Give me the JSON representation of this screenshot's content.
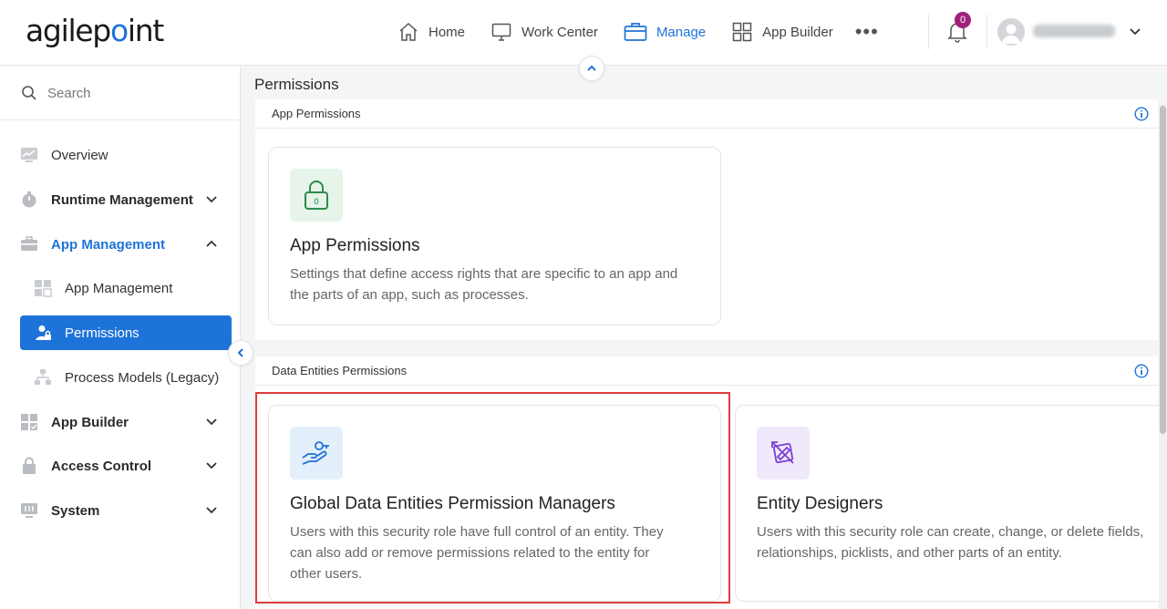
{
  "app": {
    "logo_text_a": "agilep",
    "logo_text_dot": "o",
    "logo_text_b": "int"
  },
  "header": {
    "nav": [
      {
        "label": "Home",
        "icon": "home-icon"
      },
      {
        "label": "Work Center",
        "icon": "monitor-icon"
      },
      {
        "label": "Manage",
        "icon": "briefcase-icon",
        "active": true
      },
      {
        "label": "App Builder",
        "icon": "grid-icon"
      }
    ],
    "more": "•••",
    "notification_count": "0",
    "accent_color": "#1e73d8"
  },
  "sidebar": {
    "search_placeholder": "Search",
    "items": [
      {
        "label": "Overview",
        "icon": "chart-icon"
      },
      {
        "label": "Runtime Management",
        "icon": "stopwatch-icon"
      },
      {
        "label": "App Management",
        "icon": "toolbox-icon"
      },
      {
        "label": "App Management",
        "icon": "app-tiles-icon"
      },
      {
        "label": "Permissions",
        "icon": "user-lock-icon"
      },
      {
        "label": "Process Models (Legacy)",
        "icon": "hierarchy-icon"
      },
      {
        "label": "App Builder",
        "icon": "app-builder-icon"
      },
      {
        "label": "Access Control",
        "icon": "lock-icon"
      },
      {
        "label": "System",
        "icon": "server-icon"
      }
    ]
  },
  "main": {
    "title": "Permissions",
    "app_section": {
      "heading": "App Permissions",
      "cards": [
        {
          "title": "App Permissions",
          "desc_line1": "Settings that define access rights that are specific to an app and",
          "desc_line2": "the parts of an app, such as processes."
        }
      ]
    },
    "entities_section": {
      "heading": "Data Entities Permissions",
      "cards": [
        {
          "title": "Global Data Entities Permission Managers",
          "desc_line1": "Users with this security role have full control of an entity. They",
          "desc_line2": "can also add or remove permissions related to the entity for",
          "desc_line3": "other users."
        },
        {
          "title": "Entity Designers",
          "desc_line1": "Users with this security role can create, change, or delete fields,",
          "desc_line2": "relationships, picklists, and other parts of an entity."
        }
      ]
    }
  }
}
